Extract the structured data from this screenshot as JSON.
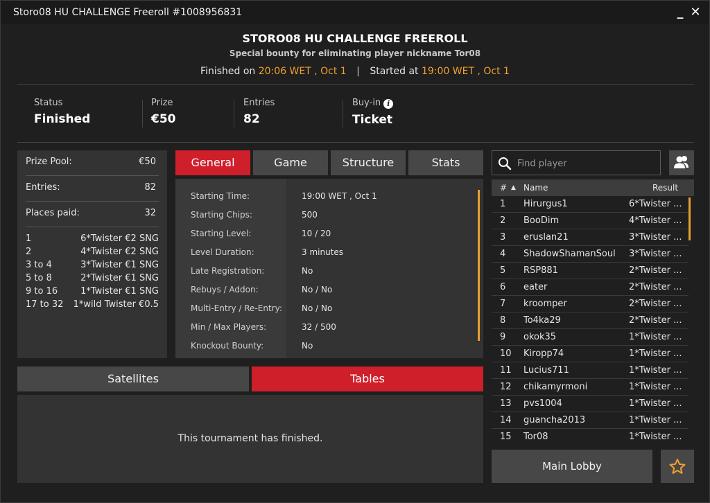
{
  "window": {
    "title": "Storo08 HU CHALLENGE Freeroll #1008956831",
    "minimize_label": "_",
    "close_label": "✕"
  },
  "header": {
    "title": "STORO08 HU CHALLENGE FREEROLL",
    "subtitle": "Special bounty for eliminating player nickname Tor08",
    "finished_label": "Finished on",
    "finished_value": "20:06 WET , Oct 1",
    "separator": "|",
    "started_label": "Started at",
    "started_value": "19:00 WET , Oct 1"
  },
  "summary": {
    "status_label": "Status",
    "status_value": "Finished",
    "prize_label": "Prize",
    "prize_value": "€50",
    "entries_label": "Entries",
    "entries_value": "82",
    "buyin_label": "Buy-in",
    "buyin_value": "Ticket",
    "info_glyph": "i"
  },
  "prize_panel": {
    "pool_label": "Prize Pool:",
    "pool_value": "€50",
    "entries_label": "Entries:",
    "entries_value": "82",
    "places_label": "Places paid:",
    "places_value": "32",
    "payouts": [
      {
        "place": "1",
        "prize": "6*Twister €2 SNG"
      },
      {
        "place": "2",
        "prize": "4*Twister €2 SNG"
      },
      {
        "place": "3  to  4",
        "prize": "3*Twister €1 SNG"
      },
      {
        "place": "5  to  8",
        "prize": "2*Twister €1 SNG"
      },
      {
        "place": "9  to  16",
        "prize": "1*Twister €1 SNG"
      },
      {
        "place": "17  to  32",
        "prize": "1*wild Twister €0.5"
      }
    ]
  },
  "tabs": {
    "general": "General",
    "game": "Game",
    "structure": "Structure",
    "stats": "Stats"
  },
  "general": {
    "rows": [
      {
        "label": "Starting Time:",
        "value": "19:00 WET , Oct 1"
      },
      {
        "label": "Starting Chips:",
        "value": "500"
      },
      {
        "label": "Starting Level:",
        "value": "10 / 20"
      },
      {
        "label": "Level Duration:",
        "value": "3 minutes"
      },
      {
        "label": "Late Registration:",
        "value": "No"
      },
      {
        "label": "Rebuys / Addon:",
        "value": "No / No"
      },
      {
        "label": "Multi-Entry / Re-Entry:",
        "value": "No / No"
      },
      {
        "label": "Min / Max Players:",
        "value": "32 / 500"
      },
      {
        "label": "Knockout Bounty:",
        "value": "No"
      }
    ]
  },
  "bottom_tabs": {
    "satellites": "Satellites",
    "tables": "Tables",
    "message": "This tournament has finished."
  },
  "search": {
    "placeholder": "Find player"
  },
  "players": {
    "col_num": "#",
    "col_name": "Name",
    "col_result": "Result",
    "sort_glyph": "▲",
    "rows": [
      {
        "num": "1",
        "name": "Hirurgus1",
        "result": "6*Twister ..."
      },
      {
        "num": "2",
        "name": "BooDim",
        "result": "4*Twister ..."
      },
      {
        "num": "3",
        "name": "eruslan21",
        "result": "3*Twister ..."
      },
      {
        "num": "4",
        "name": "ShadowShamanSoul",
        "result": "3*Twister ..."
      },
      {
        "num": "5",
        "name": "RSP881",
        "result": "2*Twister ..."
      },
      {
        "num": "6",
        "name": "eater",
        "result": "2*Twister ..."
      },
      {
        "num": "7",
        "name": "kroomper",
        "result": "2*Twister ..."
      },
      {
        "num": "8",
        "name": "To4ka29",
        "result": "2*Twister ..."
      },
      {
        "num": "9",
        "name": "okok35",
        "result": "1*Twister ..."
      },
      {
        "num": "10",
        "name": "Kiropp74",
        "result": "1*Twister ..."
      },
      {
        "num": "11",
        "name": "Lucius711",
        "result": "1*Twister ..."
      },
      {
        "num": "12",
        "name": "chikamyrmoni",
        "result": "1*Twister ..."
      },
      {
        "num": "13",
        "name": "pvs1004",
        "result": "1*Twister ..."
      },
      {
        "num": "14",
        "name": "guancha2013",
        "result": "1*Twister ..."
      },
      {
        "num": "15",
        "name": "Tor08",
        "result": "1*Twister ..."
      }
    ]
  },
  "footer": {
    "main_lobby": "Main Lobby"
  },
  "colors": {
    "accent_red": "#cf1f2a",
    "accent_orange": "#f0a030"
  }
}
